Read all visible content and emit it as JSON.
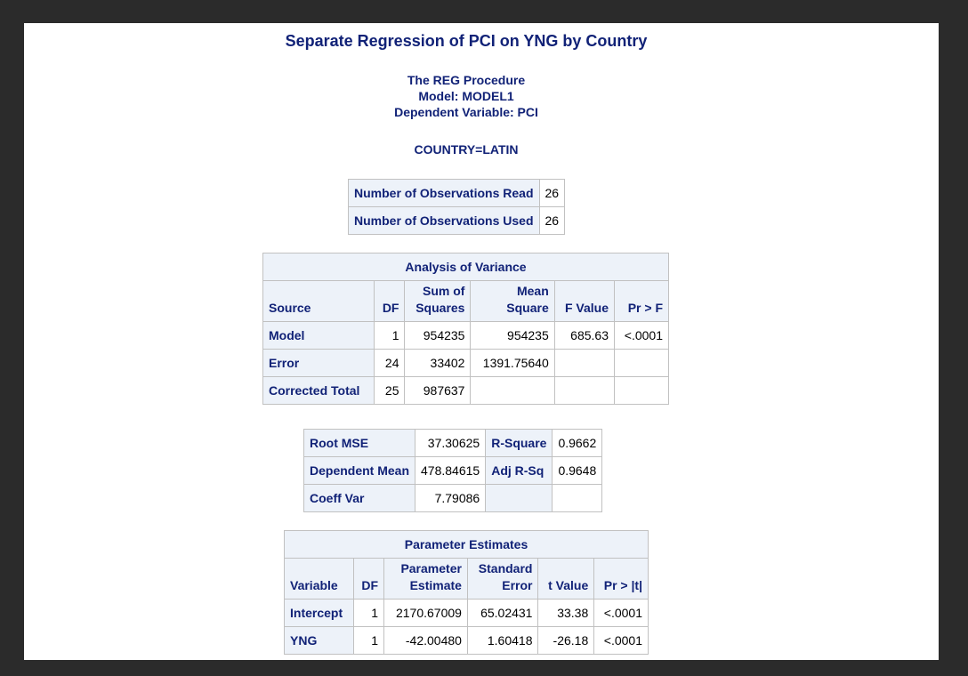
{
  "title": "Separate Regression of PCI on YNG by Country",
  "procedure": {
    "line1": "The REG Procedure",
    "line2": "Model: MODEL1",
    "line3": "Dependent Variable: PCI"
  },
  "by_group": "COUNTRY=LATIN",
  "observations": [
    {
      "label": "Number of Observations Read",
      "value": "26"
    },
    {
      "label": "Number of Observations Used",
      "value": "26"
    }
  ],
  "anova": {
    "caption": "Analysis of Variance",
    "headers": {
      "source": "Source",
      "df": "DF",
      "ss_top": "Sum of",
      "ss_bottom": "Squares",
      "ms_top": "Mean",
      "ms_bottom": "Square",
      "f": "F Value",
      "p": "Pr > F"
    },
    "rows": [
      {
        "source": "Model",
        "df": "1",
        "ss": "954235",
        "ms": "954235",
        "f": "685.63",
        "p": "<.0001"
      },
      {
        "source": "Error",
        "df": "24",
        "ss": "33402",
        "ms": "1391.75640",
        "f": "",
        "p": ""
      },
      {
        "source": "Corrected Total",
        "df": "25",
        "ss": "987637",
        "ms": "",
        "f": "",
        "p": ""
      }
    ]
  },
  "fit": {
    "rows": [
      {
        "l1": "Root MSE",
        "v1": "37.30625",
        "l2": "R-Square",
        "v2": "0.9662"
      },
      {
        "l1": "Dependent Mean",
        "v1": "478.84615",
        "l2": "Adj R-Sq",
        "v2": "0.9648"
      },
      {
        "l1": "Coeff Var",
        "v1": "7.79086",
        "l2": "",
        "v2": ""
      }
    ]
  },
  "params": {
    "caption": "Parameter Estimates",
    "headers": {
      "variable": "Variable",
      "df": "DF",
      "est_top": "Parameter",
      "est_bottom": "Estimate",
      "se_top": "Standard",
      "se_bottom": "Error",
      "t": "t Value",
      "p": "Pr > |t|"
    },
    "rows": [
      {
        "variable": "Intercept",
        "df": "1",
        "est": "2170.67009",
        "se": "65.02431",
        "t": "33.38",
        "p": "<.0001"
      },
      {
        "variable": "YNG",
        "df": "1",
        "est": "-42.00480",
        "se": "1.60418",
        "t": "-26.18",
        "p": "<.0001"
      }
    ]
  }
}
